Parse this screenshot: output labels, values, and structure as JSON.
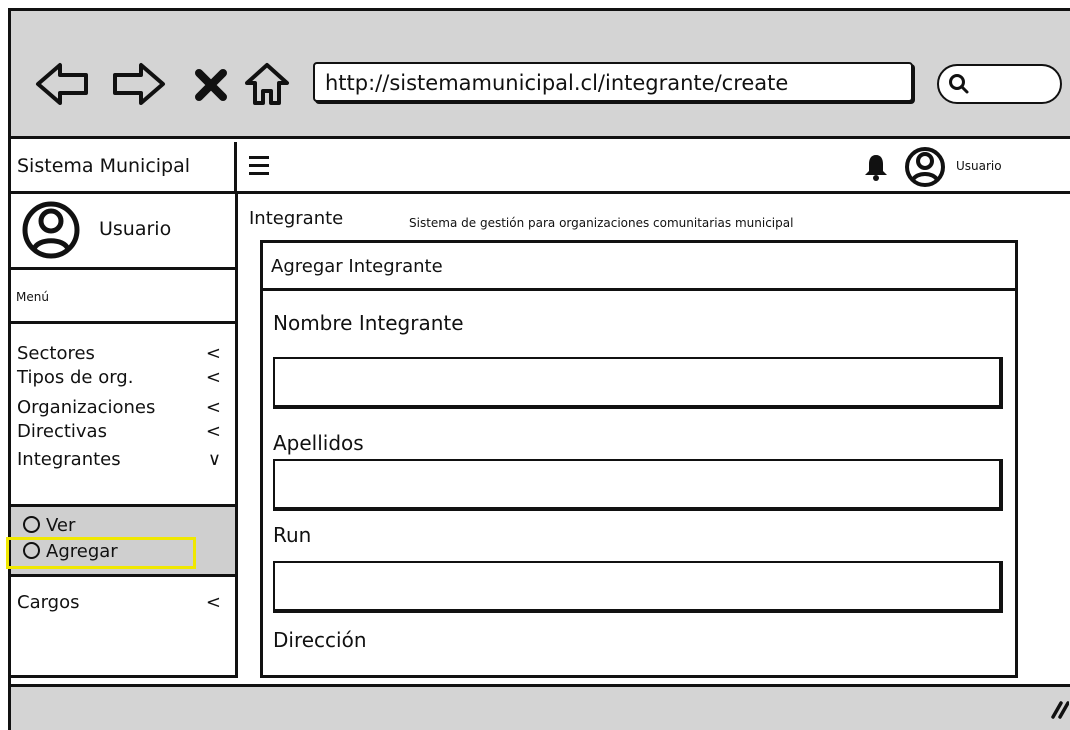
{
  "browser": {
    "url": "http://sistemamunicipal.cl/integrante/create",
    "nav_icons": [
      "back-arrow-icon",
      "forward-arrow-icon",
      "close-icon",
      "home-icon"
    ],
    "search_icon": "search-icon"
  },
  "header": {
    "brand": "Sistema Municipal",
    "user_label": "Usuario",
    "icons": [
      "hamburger-icon",
      "bell-icon",
      "user-avatar-icon"
    ]
  },
  "sidebar": {
    "user_name": "Usuario",
    "menu_label": "Menú",
    "items": [
      {
        "label": "Sectores",
        "chevron": "<"
      },
      {
        "label": "Tipos de org.",
        "chevron": "<"
      },
      {
        "label": "Organizaciones",
        "chevron": "<"
      },
      {
        "label": "Directivas",
        "chevron": "<"
      },
      {
        "label": "Integrantes",
        "chevron": "∨"
      }
    ],
    "submenu": [
      {
        "label": "Ver"
      },
      {
        "label": "Agregar"
      }
    ],
    "highlight_color": "#f0e800",
    "cargos": {
      "label": "Cargos",
      "chevron": "<"
    }
  },
  "main": {
    "title": "Integrante",
    "subtitle": "Sistema de gestión para organizaciones comunitarias municipal",
    "card_title": "Agregar Integrante",
    "fields": {
      "nombre": "Nombre Integrante",
      "apellidos": "Apellidos",
      "run": "Run",
      "direccion": "Dirección"
    }
  },
  "colors": {
    "chrome_gray": "#d4d4d4",
    "submenu_gray": "#cfcfcf",
    "ink": "#111111"
  }
}
